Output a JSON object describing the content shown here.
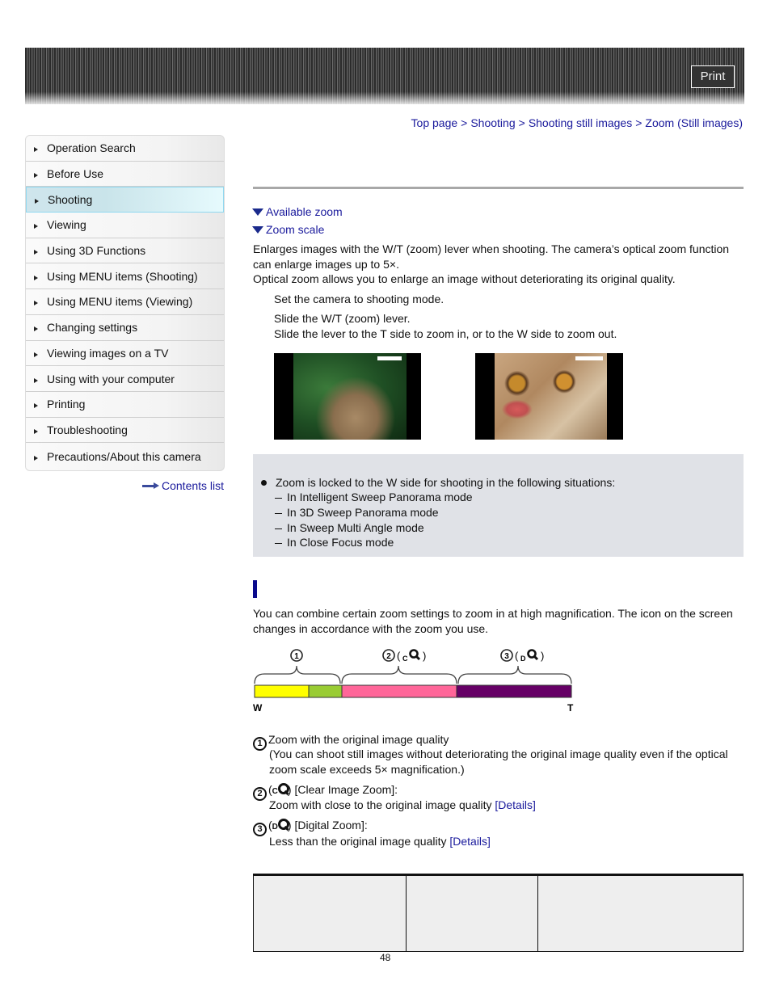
{
  "header": {
    "print_label": "Print"
  },
  "breadcrumb": {
    "items": [
      "Top page",
      "Shooting",
      "Shooting still images",
      "Zoom (Still images)"
    ],
    "separator": ">"
  },
  "sidebar": {
    "items": [
      {
        "label": "Operation Search",
        "active": false
      },
      {
        "label": "Before Use",
        "active": false
      },
      {
        "label": "Shooting",
        "active": true
      },
      {
        "label": "Viewing",
        "active": false
      },
      {
        "label": "Using 3D Functions",
        "active": false
      },
      {
        "label": "Using MENU items (Shooting)",
        "active": false
      },
      {
        "label": "Using MENU items (Viewing)",
        "active": false
      },
      {
        "label": "Changing settings",
        "active": false
      },
      {
        "label": "Viewing images on a TV",
        "active": false
      },
      {
        "label": "Using with your computer",
        "active": false
      },
      {
        "label": "Printing",
        "active": false
      },
      {
        "label": "Troubleshooting",
        "active": false
      },
      {
        "label": "Precautions/About this camera",
        "active": false
      }
    ],
    "contents_link": "Contents list"
  },
  "main": {
    "anchors": [
      "Available zoom",
      "Zoom scale"
    ],
    "intro": [
      "Enlarges images with the W/T (zoom) lever when shooting. The camera’s optical zoom function",
      "can enlarge images up to 5×.",
      "Optical zoom allows you to enlarge an image without deteriorating its original quality."
    ],
    "steps": [
      "Set the camera to shooting mode.",
      "Slide the W/T (zoom) lever.",
      "Slide the lever to the T side to zoom in, or to the W side to zoom out."
    ],
    "images": [
      {
        "alt": "Cat photo at W (wide) zoom"
      },
      {
        "alt": "Cat photo at T (telephoto) zoom"
      }
    ],
    "note": {
      "bullet": "Zoom is locked to the W side for shooting in the following situations:",
      "items": [
        "In Intelligent Sweep Panorama mode",
        "In 3D Sweep Panorama mode",
        "In Sweep Multi Angle mode",
        "In Close Focus mode"
      ]
    },
    "section_text": [
      "You can combine certain zoom settings to zoom in at high magnification. The icon on the screen",
      "changes in accordance with the zoom you use."
    ],
    "scale": {
      "w_label": "W",
      "t_label": "T",
      "labels": [
        "①",
        "②",
        "③"
      ],
      "c_letter": "C",
      "d_letter": "D",
      "colors": {
        "optical": "#ffff00",
        "smart": "#99cc33",
        "clear": "#ff6699",
        "digital": "#660066"
      }
    },
    "legend": [
      {
        "num": "1",
        "title": "Zoom with the original image quality",
        "lines": [
          "(You can shoot still images without deteriorating the original image quality even if the optical",
          "zoom scale exceeds 5× magnification.)"
        ]
      },
      {
        "num": "2",
        "letter": "C",
        "title": "[Clear Image Zoom]:",
        "line": "Zoom with close to the original image quality",
        "link": "[Details]"
      },
      {
        "num": "3",
        "letter": "D",
        "title": "[Digital Zoom]:",
        "line": "Less than the original image quality",
        "link": "[Details]"
      }
    ]
  },
  "footer": {
    "page_number": "48"
  }
}
